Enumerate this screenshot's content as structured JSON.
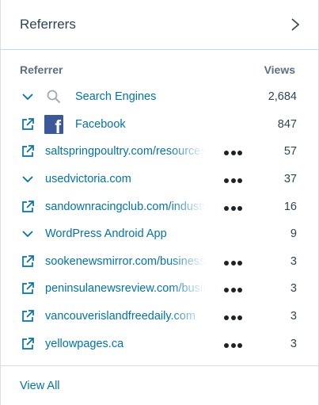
{
  "panel": {
    "title": "Referrers"
  },
  "columns": {
    "referrer": "Referrer",
    "views": "Views"
  },
  "rows": [
    {
      "label": "Search Engines",
      "views": "2,684",
      "lead": "chevron-down-icon",
      "icon": "search-icon",
      "menu": false
    },
    {
      "label": "Facebook",
      "views": "847",
      "lead": "external-link-icon",
      "icon": "facebook-icon",
      "menu": false
    },
    {
      "label": "saltspringpoultry.com/resources",
      "views": "57",
      "lead": "external-link-icon",
      "menu": true
    },
    {
      "label": "usedvictoria.com",
      "views": "37",
      "lead": "chevron-down-icon",
      "menu": true
    },
    {
      "label": "sandownracingclub.com/industry",
      "views": "16",
      "lead": "external-link-icon",
      "menu": true
    },
    {
      "label": "WordPress Android App",
      "views": "9",
      "lead": "chevron-down-icon",
      "menu": false
    },
    {
      "label": "sookenewsmirror.com/business",
      "views": "3",
      "lead": "external-link-icon",
      "menu": true
    },
    {
      "label": "peninsulanewsreview.com/business",
      "views": "3",
      "lead": "external-link-icon",
      "menu": true
    },
    {
      "label": "vancouverislandfreedaily.com",
      "views": "3",
      "lead": "external-link-icon",
      "menu": true
    },
    {
      "label": "yellowpages.ca",
      "views": "3",
      "lead": "external-link-icon",
      "menu": true
    }
  ],
  "footer": {
    "view_all": "View All"
  },
  "colors": {
    "link": "#0073aa",
    "text": "#2e4453",
    "facebook": "#3b5998",
    "divider": "#c8d7e1"
  }
}
